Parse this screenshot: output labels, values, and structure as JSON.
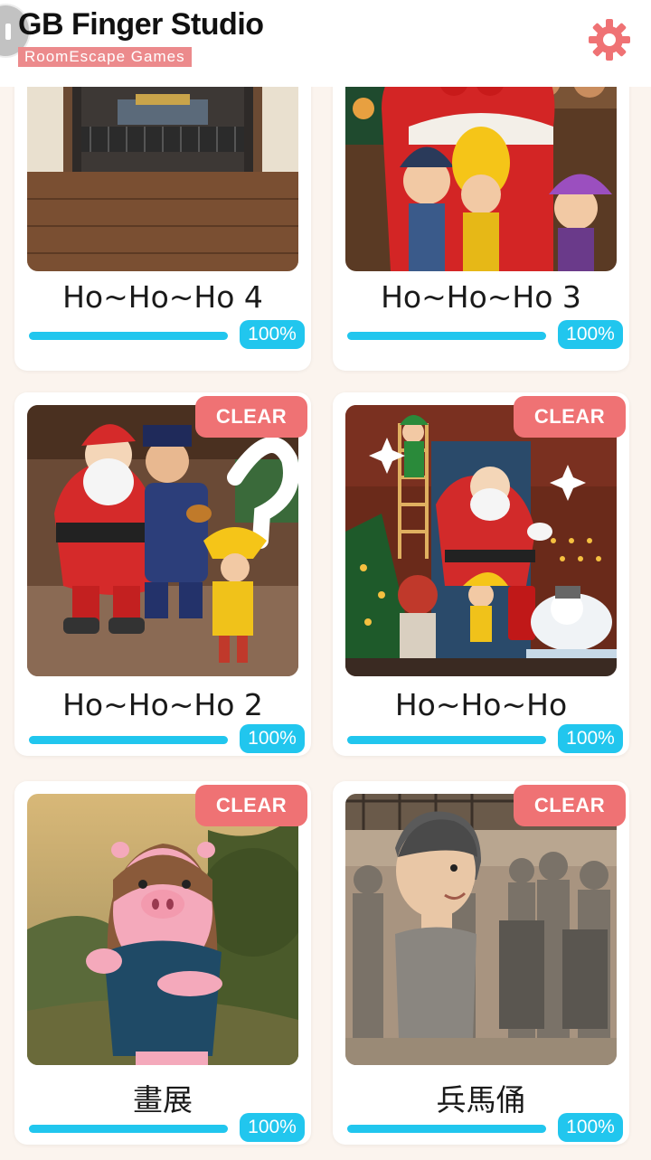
{
  "header": {
    "title": "GB Finger Studio",
    "subtitle": "RoomEscape  Games"
  },
  "colors": {
    "accent_pink": "#ef7274",
    "progress_blue": "#21c6ee",
    "background": "#fbf4ee"
  },
  "icons": {
    "settings": "gear-icon",
    "back": "back-icon"
  },
  "games": [
    {
      "title": "Ho~Ho~Ho 4",
      "progress_label": "100%",
      "progress": 1.0,
      "clear_label": ""
    },
    {
      "title": "Ho~Ho~Ho 3",
      "progress_label": "100%",
      "progress": 1.0,
      "clear_label": ""
    },
    {
      "title": "Ho~Ho~Ho 2",
      "progress_label": "100%",
      "progress": 1.0,
      "clear_label": "CLEAR"
    },
    {
      "title": "Ho~Ho~Ho",
      "progress_label": "100%",
      "progress": 1.0,
      "clear_label": "CLEAR"
    },
    {
      "title": "畫展",
      "progress_label": "100%",
      "progress": 1.0,
      "clear_label": "CLEAR"
    },
    {
      "title": "兵馬俑",
      "progress_label": "100%",
      "progress": 1.0,
      "clear_label": "CLEAR"
    }
  ]
}
